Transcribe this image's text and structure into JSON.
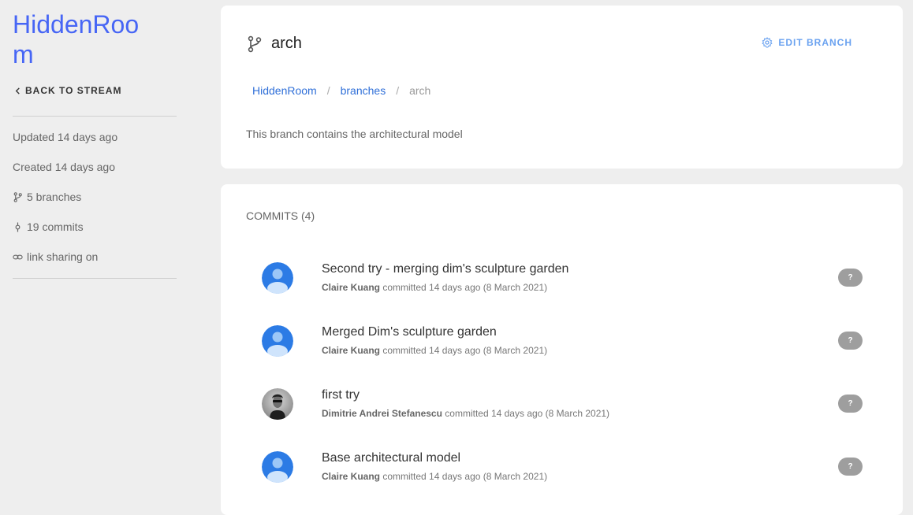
{
  "sidebar": {
    "stream_title": "HiddenRoom",
    "back_label": "BACK TO STREAM",
    "updated": "Updated 14 days ago",
    "created": "Created 14 days ago",
    "branches": "5 branches",
    "commits": "19 commits",
    "link_sharing": "link sharing on"
  },
  "branch": {
    "name": "arch",
    "edit_label": "EDIT BRANCH",
    "breadcrumb": [
      "HiddenRoom",
      "branches",
      "arch"
    ],
    "breadcrumb_sep": "/",
    "description": "This branch contains the architectural model"
  },
  "commits": {
    "title": "COMMITS (4)",
    "items": [
      {
        "message": "Second try - merging dim's sculpture garden",
        "author": "Claire Kuang",
        "meta": " committed 14 days ago (8 March 2021)",
        "badge": "?",
        "avatar": "default-avatar"
      },
      {
        "message": "Merged Dim's sculpture garden",
        "author": "Claire Kuang",
        "meta": " committed 14 days ago (8 March 2021)",
        "badge": "?",
        "avatar": "default-avatar"
      },
      {
        "message": "first try",
        "author": "Dimitrie Andrei Stefanescu",
        "meta": " committed 14 days ago (8 March 2021)",
        "badge": "?",
        "avatar": "photo-avatar"
      },
      {
        "message": "Base architectural model",
        "author": "Claire Kuang",
        "meta": " committed 14 days ago (8 March 2021)",
        "badge": "?",
        "avatar": "default-avatar"
      }
    ]
  },
  "colors": {
    "accent": "#4766f5",
    "link": "#2f6fd8",
    "badge": "#9e9e9e",
    "avatar_blue": "#2c7be5"
  }
}
